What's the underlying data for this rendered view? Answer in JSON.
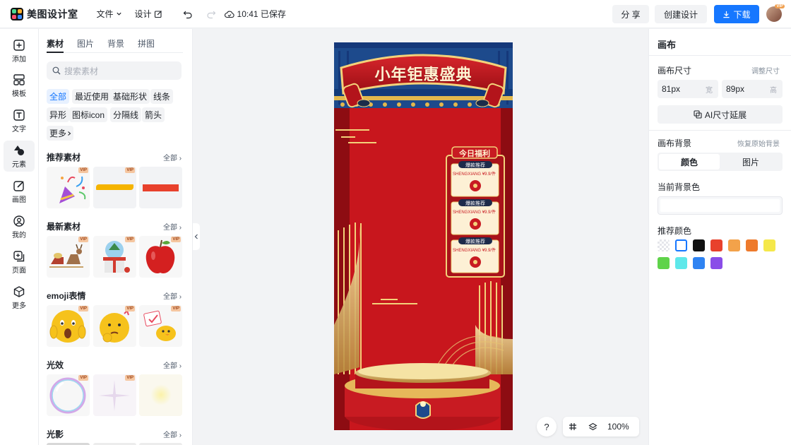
{
  "app": {
    "name": "美图设计室"
  },
  "topbar": {
    "file_label": "文件",
    "design_label": "设计",
    "save_status": "10:41 已保存",
    "share_label": "分 享",
    "create_label": "创建设计",
    "download_label": "下载",
    "avatar_badge": "VIP"
  },
  "rail": {
    "items": [
      {
        "label": "添加",
        "icon": "plus-square-icon"
      },
      {
        "label": "模板",
        "icon": "template-icon"
      },
      {
        "label": "文字",
        "icon": "text-icon"
      },
      {
        "label": "元素",
        "icon": "element-icon"
      },
      {
        "label": "画图",
        "icon": "draw-icon"
      },
      {
        "label": "我的",
        "icon": "user-icon"
      },
      {
        "label": "页面",
        "icon": "page-icon"
      },
      {
        "label": "更多",
        "icon": "cube-icon"
      }
    ]
  },
  "panel": {
    "tabs": [
      "素材",
      "图片",
      "背景",
      "拼图"
    ],
    "search_placeholder": "搜索素材",
    "chips": [
      "全部",
      "最近使用",
      "基础形状",
      "线条",
      "异形",
      "图标icon",
      "分隔线",
      "箭头",
      "更多"
    ],
    "sections": [
      {
        "title": "推荐素材",
        "all": "全部"
      },
      {
        "title": "最新素材",
        "all": "全部"
      },
      {
        "title": "emoji表情",
        "all": "全部"
      },
      {
        "title": "光效",
        "all": "全部"
      },
      {
        "title": "光影",
        "all": "全部"
      }
    ],
    "vip_label": "VIP"
  },
  "poster": {
    "banner_title": "小年钜惠盛典",
    "benefit_title": "今日福利",
    "cards": [
      {
        "tag": "爆款推荐",
        "price": "¥9.9/件",
        "note": "SHENGXIANG"
      },
      {
        "tag": "爆款推荐",
        "price": "¥9.9/件",
        "note": "SHENGXIANG"
      },
      {
        "tag": "爆款推荐",
        "price": "¥9.9/件",
        "note": "SHENGXIANG"
      }
    ]
  },
  "canvas_tools": {
    "help": "?",
    "zoom": "100%"
  },
  "right": {
    "title": "画布",
    "size_label": "画布尺寸",
    "resize_label": "调整尺寸",
    "width_value": "81px",
    "width_unit": "宽",
    "height_value": "89px",
    "height_unit": "高",
    "ai_extend_label": "AI尺寸延展",
    "bg_label": "画布背景",
    "restore_label": "恢复原始背景",
    "seg_color": "颜色",
    "seg_image": "图片",
    "current_bg_label": "当前背景色",
    "recommend_label": "推荐颜色",
    "swatches": [
      "transparent",
      "#ffffff",
      "#111111",
      "#e8412c",
      "#f3a24a",
      "#ee7a2c",
      "#f5e84a",
      "#5fd34a",
      "#5ee8ea",
      "#2f83f2",
      "#8a4de8"
    ]
  }
}
